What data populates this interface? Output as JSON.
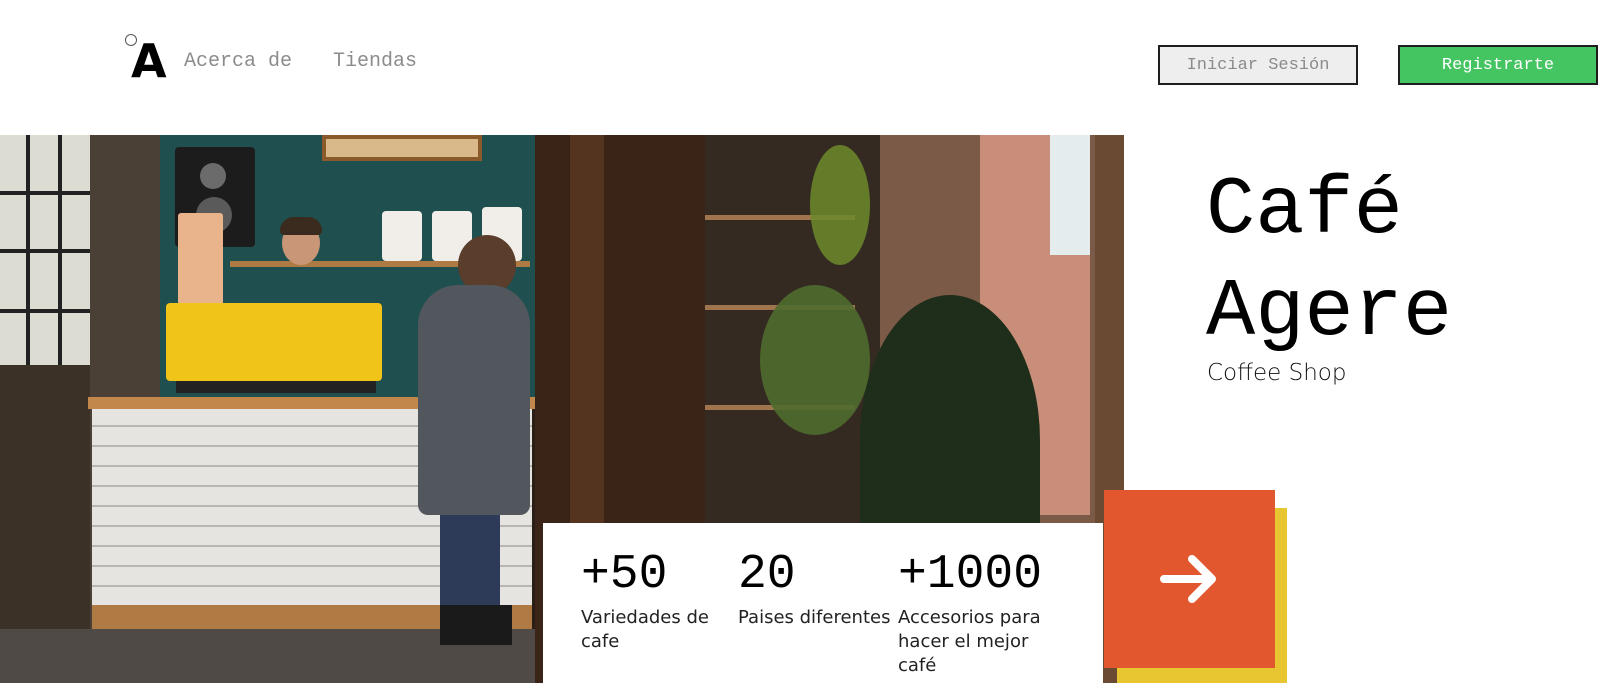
{
  "header": {
    "logo_text": "A",
    "nav": {
      "about_label": "Acerca de",
      "stores_label": "Tiendas"
    },
    "login_label": "Iniciar Sesión",
    "register_label": "Registrarte"
  },
  "hero": {
    "image_icon": "coffee-shop-photo",
    "title": "Café Agere",
    "subtitle": "Coffee Shop",
    "cta_icon": "arrow-right-icon"
  },
  "stats": [
    {
      "value": "+50",
      "label": "Variedades de cafe"
    },
    {
      "value": "20",
      "label": "Paises diferentes"
    },
    {
      "value": "+1000",
      "label": "Accesorios para hacer el mejor café"
    }
  ],
  "colors": {
    "accent_orange": "#e2572e",
    "accent_yellow": "#e8c631",
    "register_green": "#45c562",
    "login_gray": "#eeeeee",
    "nav_text": "#8c8c8c"
  }
}
